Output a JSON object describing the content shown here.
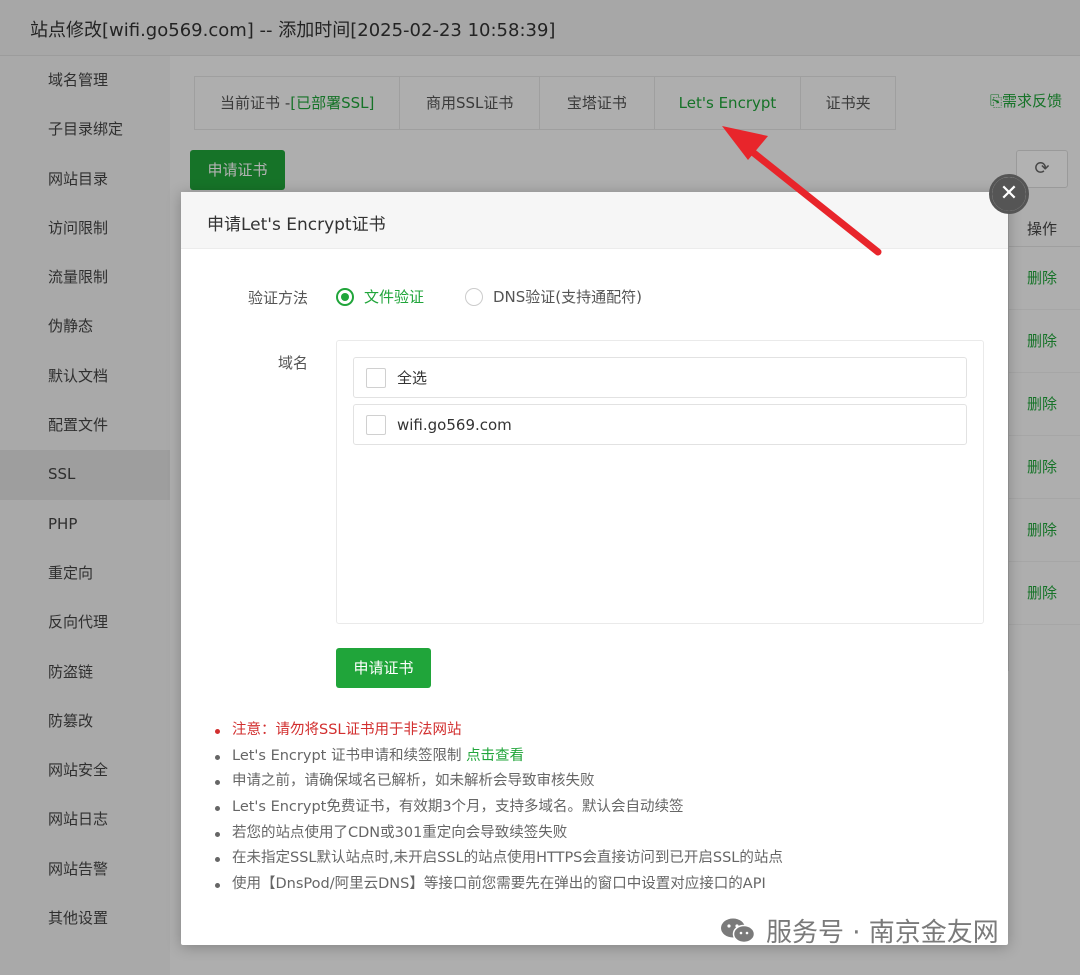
{
  "window": {
    "title": "站点修改[wifi.go569.com] -- 添加时间[2025-02-23 10:58:39]"
  },
  "sidebar": {
    "items": [
      {
        "label": "域名管理"
      },
      {
        "label": "子目录绑定"
      },
      {
        "label": "网站目录"
      },
      {
        "label": "访问限制"
      },
      {
        "label": "流量限制"
      },
      {
        "label": "伪静态"
      },
      {
        "label": "默认文档"
      },
      {
        "label": "配置文件"
      },
      {
        "label": "SSL"
      },
      {
        "label": "PHP"
      },
      {
        "label": "重定向"
      },
      {
        "label": "反向代理"
      },
      {
        "label": "防盗链"
      },
      {
        "label": "防篡改"
      },
      {
        "label": "网站安全"
      },
      {
        "label": "网站日志"
      },
      {
        "label": "网站告警"
      },
      {
        "label": "其他设置"
      }
    ],
    "active_index": 8
  },
  "tabs": [
    {
      "label": "当前证书 -",
      "label_suffix": "[已部署SSL]"
    },
    {
      "label": "商用SSL证书"
    },
    {
      "label": "宝塔证书"
    },
    {
      "label": "Let's Encrypt"
    },
    {
      "label": "证书夹"
    }
  ],
  "active_tab": 3,
  "feedback_label": "需求反馈",
  "background_apply_label": "申请证书",
  "ops_column": {
    "header": "操作",
    "cells": [
      "删除",
      "删除",
      "删除",
      "删除",
      "删除",
      "删除"
    ]
  },
  "modal": {
    "title": "申请Let's Encrypt证书",
    "verify_label": "验证方法",
    "verify_options": [
      {
        "label": "文件验证",
        "selected": true
      },
      {
        "label": "DNS验证(支持通配符)",
        "selected": false
      }
    ],
    "domain_label": "域名",
    "domains": [
      {
        "label": "全选",
        "checked": false
      },
      {
        "label": "wifi.go569.com",
        "checked": false
      }
    ],
    "apply_label": "申请证书",
    "notes": [
      {
        "text": "注意：请勿将SSL证书用于非法网站",
        "warn": true
      },
      {
        "text": "Let's Encrypt 证书申请和续签限制 ",
        "link": "点击查看"
      },
      {
        "text": "申请之前，请确保域名已解析，如未解析会导致审核失败"
      },
      {
        "text": "Let's Encrypt免费证书，有效期3个月，支持多域名。默认会自动续签"
      },
      {
        "text": "若您的站点使用了CDN或301重定向会导致续签失败"
      },
      {
        "text": "在未指定SSL默认站点时,未开启SSL的站点使用HTTPS会直接访问到已开启SSL的站点"
      },
      {
        "text": "使用【DnsPod/阿里云DNS】等接口前您需要先在弹出的窗口中设置对应接口的API"
      }
    ]
  },
  "watermark": "服务号 · 南京金友网",
  "colors": {
    "accent": "#20a53a",
    "warn": "#d22f2f",
    "arrow": "#e8252b"
  }
}
